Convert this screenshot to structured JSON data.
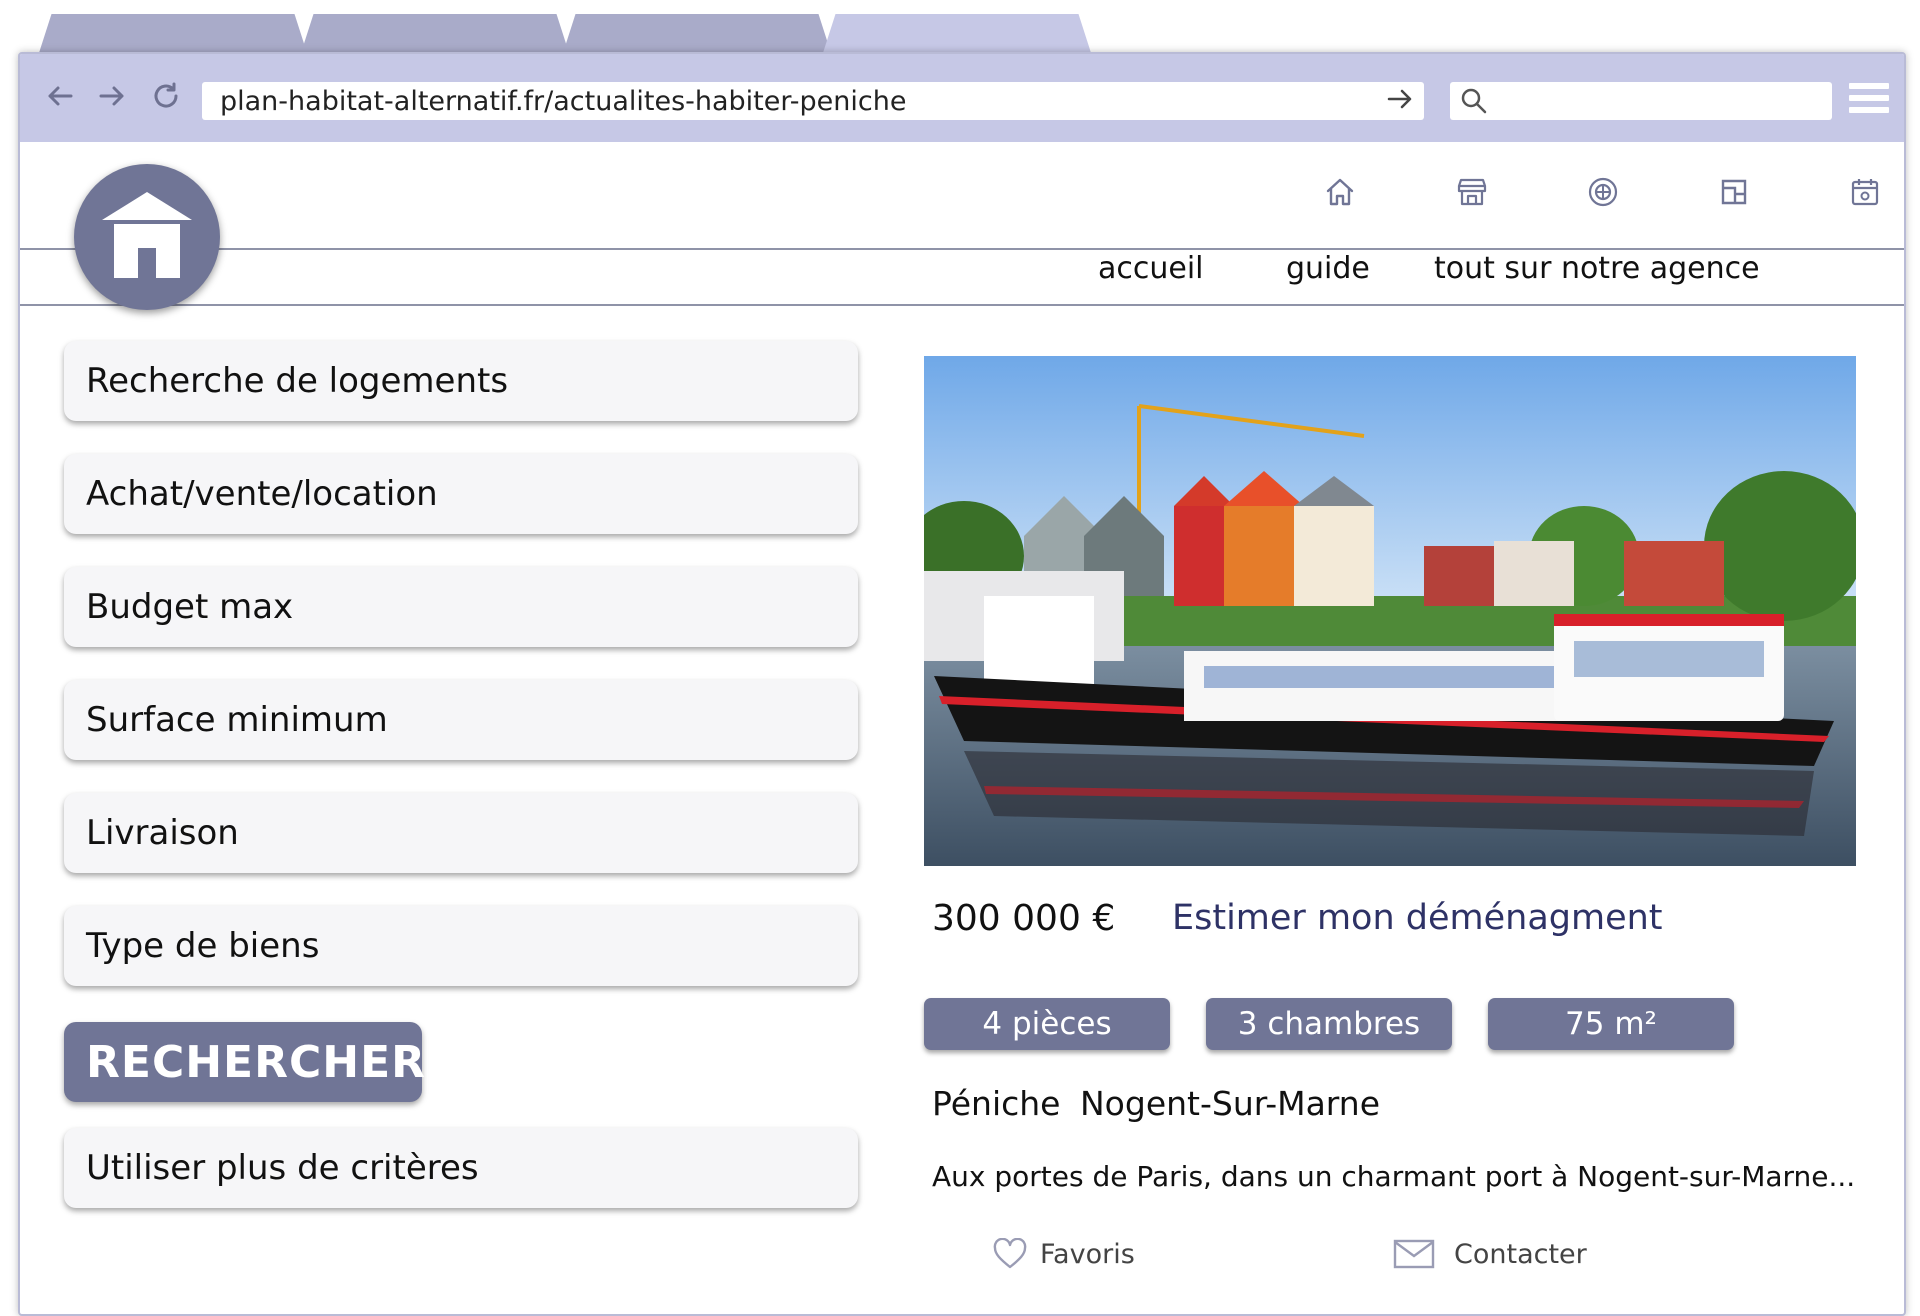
{
  "browser": {
    "url": "plan-habitat-alternatif.fr/actualites-habiter-peniche",
    "search_placeholder": ""
  },
  "icons": {
    "back": "arrow-left-icon",
    "forward": "arrow-right-icon",
    "reload": "reload-icon",
    "go": "go-arrow-icon",
    "search": "search-icon",
    "menu": "hamburger-menu-icon",
    "logo": "house-logo-icon",
    "nav": [
      "home-icon",
      "store-icon",
      "badge-icon",
      "floorplan-icon",
      "calendar-icon"
    ],
    "favorite": "heart-icon",
    "contact": "envelope-icon"
  },
  "nav": {
    "links": [
      "accueil",
      "guide",
      "tout sur notre agence"
    ]
  },
  "criteria": [
    "Recherche de logements",
    "Achat/vente/location",
    "Budget max",
    "Surface minimum",
    "Livraison",
    "Type de biens"
  ],
  "search_button": "RECHERCHER",
  "more_criteria": "Utiliser plus de critères",
  "listing": {
    "price": "300 000 €",
    "estimate_link": "Estimer mon déménagment",
    "features": [
      "4 pièces",
      "3 chambres",
      "75 m²"
    ],
    "type": "Péniche",
    "city": "Nogent-Sur-Marne",
    "description": "Aux portes de Paris, dans un charmant port à Nogent-sur-Marne...",
    "favorite_label": "Favoris",
    "contact_label": "Contacter"
  },
  "colors": {
    "accent": "#707596",
    "toolbar": "#c6c8e6",
    "link": "#2e3266"
  }
}
